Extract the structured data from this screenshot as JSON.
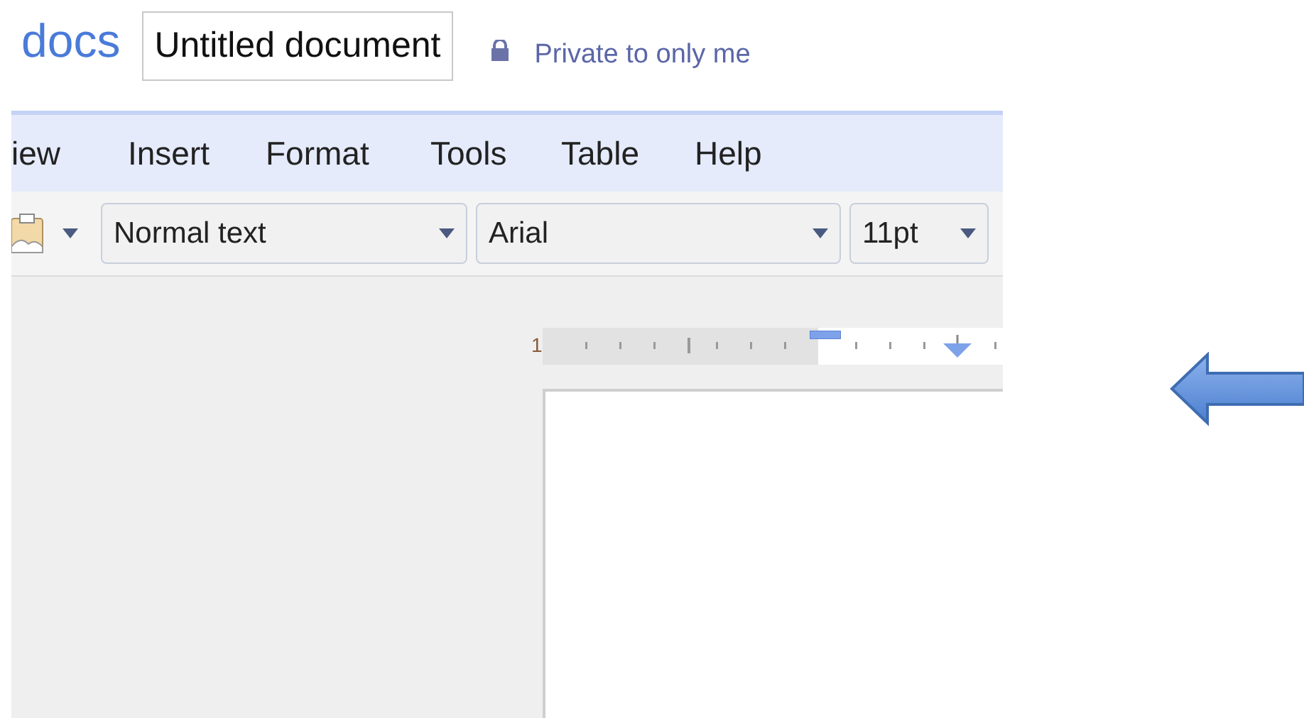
{
  "header": {
    "logo": "docs",
    "title": "Untitled document",
    "sharing": "Private to only me"
  },
  "menu": [
    "iew",
    "Insert",
    "Format",
    "Tools",
    "Table",
    "Help"
  ],
  "toolbar": {
    "style": "Normal text",
    "font": "Arial",
    "size": "11pt"
  },
  "ruler": {
    "label": "1"
  }
}
